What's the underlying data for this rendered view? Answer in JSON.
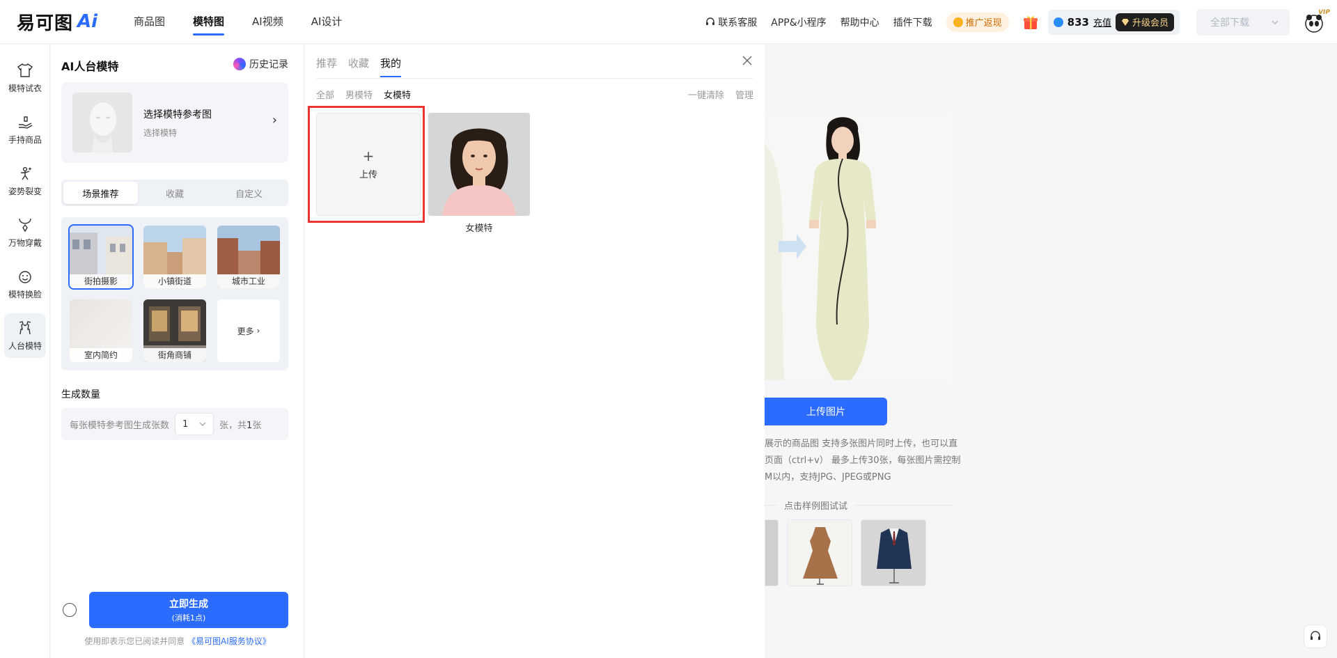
{
  "brand": {
    "logo_text": "易可图",
    "logo_ai": "Ai"
  },
  "nav": [
    {
      "label": "商品图"
    },
    {
      "label": "模特图",
      "active": true
    },
    {
      "label": "AI视频"
    },
    {
      "label": "AI设计"
    }
  ],
  "top_right": {
    "support": "联系客服",
    "app": "APP&小程序",
    "help": "帮助中心",
    "plugin": "插件下载",
    "promo": "推广返现",
    "points": "833",
    "recharge": "充值",
    "upgrade": "升级会员",
    "download_all": "全部下载",
    "vip_badge": "VIP"
  },
  "left_nav": [
    {
      "label": "模特试衣",
      "icon": "shirt-icon"
    },
    {
      "label": "手持商品",
      "icon": "hand-icon"
    },
    {
      "label": "姿势裂变",
      "icon": "pose-icon"
    },
    {
      "label": "万物穿戴",
      "icon": "necklace-icon"
    },
    {
      "label": "模特换脸",
      "icon": "face-icon"
    },
    {
      "label": "人台模特",
      "icon": "mannequin-icon",
      "active": true
    }
  ],
  "panel": {
    "title": "AI人台模特",
    "history": "历史记录",
    "ref_title": "选择模特参考图",
    "ref_sub": "选择模特",
    "segments": [
      "场景推荐",
      "收藏",
      "自定义"
    ],
    "scenes": [
      {
        "label": "街拍摄影",
        "selected": true
      },
      {
        "label": "小镇街道"
      },
      {
        "label": "城市工业"
      },
      {
        "label": "室内简约"
      },
      {
        "label": "街角商铺"
      }
    ],
    "more": "更多",
    "qty_title": "生成数量",
    "qty_prefix": "每张模特参考图生成张数",
    "qty_value": "1",
    "qty_suffix_a": "张，共",
    "qty_total": "1",
    "qty_suffix_b": "张",
    "generate": "立即生成",
    "generate_sub": "(消耗1点)",
    "agree_prefix": "使用即表示您已阅读并同意",
    "agree_link": "《易可图AI服务协议》"
  },
  "drawer": {
    "tabs": [
      "推荐",
      "收藏",
      "我的"
    ],
    "active_tab": "我的",
    "filters": [
      "全部",
      "男模特",
      "女模特"
    ],
    "active_filter": "女模特",
    "clear": "一键清除",
    "manage": "管理",
    "upload": "上传",
    "plus": "+",
    "model_label": "女模特"
  },
  "canvas": {
    "upload_btn": "上传图片",
    "desc_1": "展示的商品图 支持多张图片同时上传，也可以直",
    "desc_2": "页面（ctrl+v） 最多上传30张，每张图片需控制",
    "desc_3": "M以内，支持JPG、JPEG或PNG",
    "try": "点击样例图试试"
  },
  "colors": {
    "accent": "#2b6bff",
    "highlight": "#e33333"
  }
}
